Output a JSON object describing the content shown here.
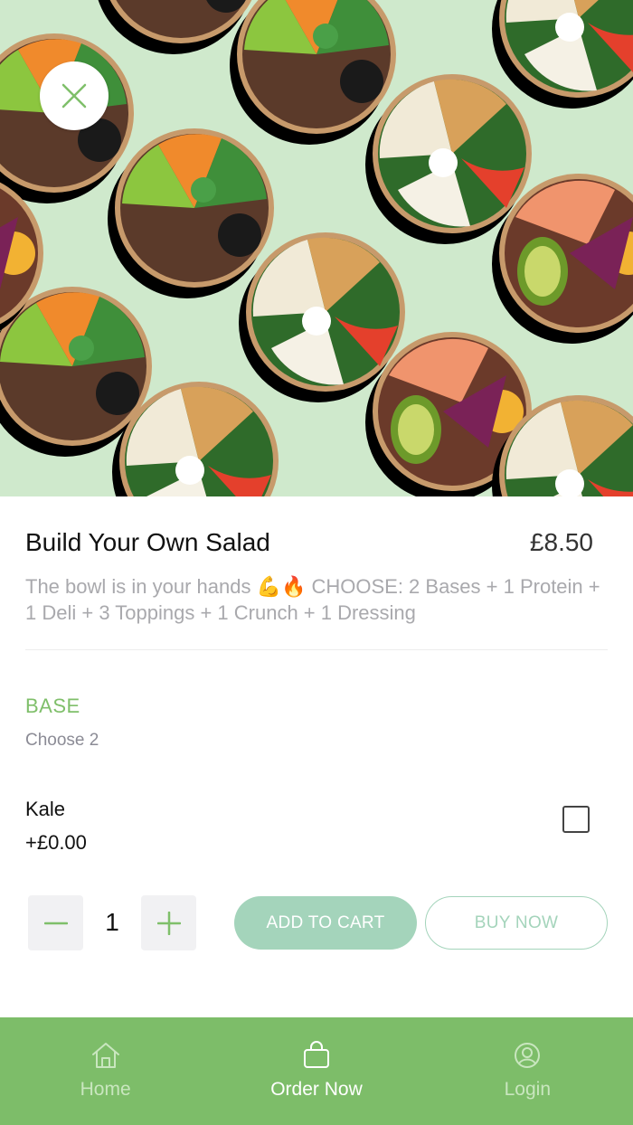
{
  "hero": {
    "background_color": "#cfe9cc",
    "image": "salad-bowls-pattern"
  },
  "close_button": {
    "icon": "close-icon",
    "color": "#7fbf6a"
  },
  "product": {
    "title": "Build Your Own Salad",
    "price": "£8.50",
    "description": "The bowl is in your hands 💪🔥 CHOOSE: 2 Bases + 1 Protein + 1 Deli + 3 Toppings + 1 Crunch + 1 Dressing"
  },
  "section": {
    "title": "BASE",
    "subtitle": "Choose 2",
    "options": [
      {
        "name": "Kale",
        "price": "+£0.00",
        "checked": false
      }
    ]
  },
  "quantity": {
    "value": "1"
  },
  "actions": {
    "add_to_cart": "ADD TO CART",
    "buy_now": "BUY NOW"
  },
  "colors": {
    "accent": "#7fbf6a",
    "nav_bg": "#7dbd69",
    "button": "#a4d4bb"
  },
  "nav": {
    "items": [
      {
        "label": "Home",
        "icon": "home-icon",
        "active": false
      },
      {
        "label": "Order Now",
        "icon": "shopping-bag-icon",
        "active": true
      },
      {
        "label": "Login",
        "icon": "user-icon",
        "active": false
      }
    ]
  }
}
